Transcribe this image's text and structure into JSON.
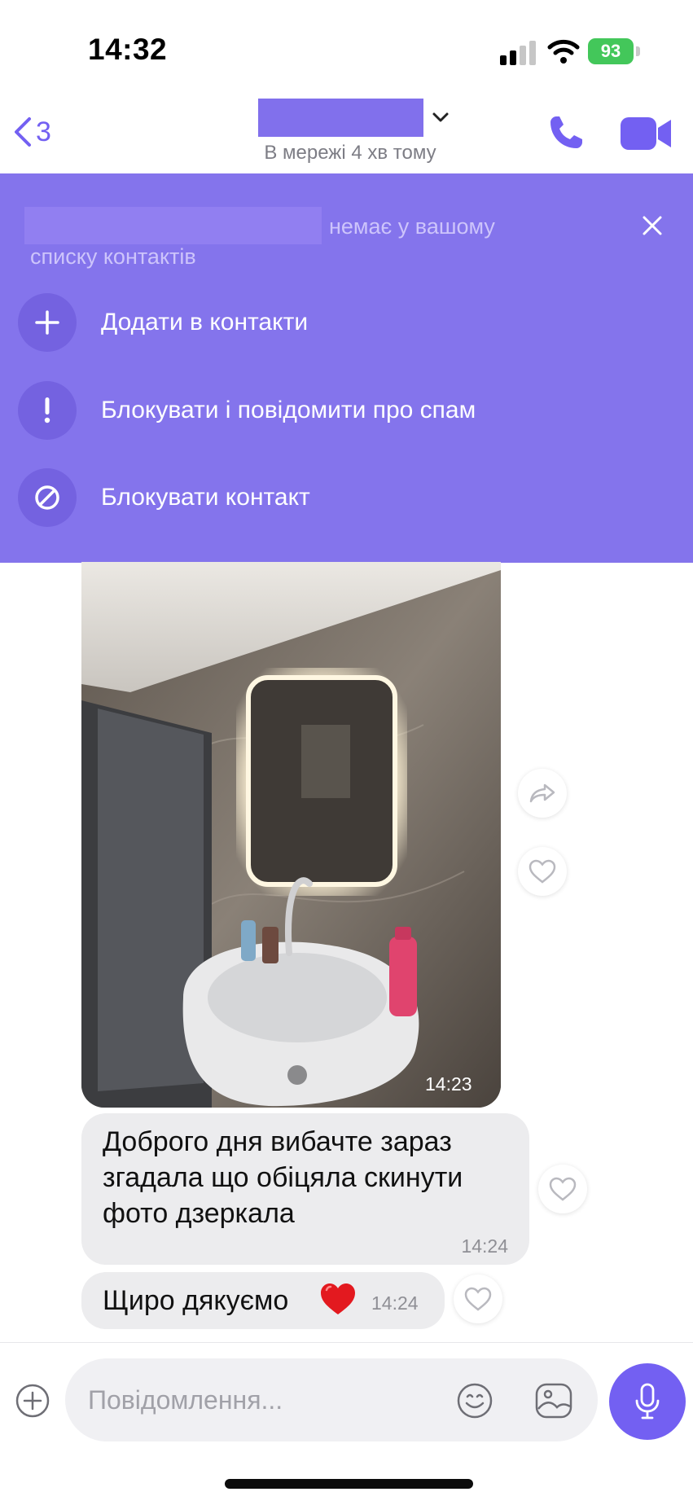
{
  "status_bar": {
    "time": "14:32",
    "battery": "93"
  },
  "header": {
    "back_count": "3",
    "last_seen": "В мережі 4 хв тому",
    "icons": [
      "chevron-left-icon",
      "chevron-down-icon",
      "phone-icon",
      "video-camera-icon"
    ]
  },
  "banner": {
    "not_in_contacts_line1": "немає у вашому",
    "not_in_contacts_line2": "списку контактів",
    "actions": [
      {
        "label": "Додати в контакти",
        "icon": "plus-icon"
      },
      {
        "label": "Блокувати і повідомити про спам",
        "icon": "exclamation-icon"
      },
      {
        "label": "Блокувати контакт",
        "icon": "block-icon"
      }
    ]
  },
  "messages": [
    {
      "type": "photo",
      "time": "14:23"
    },
    {
      "type": "text",
      "lines": [
        "Доброго дня вибачте зараз",
        "згадала що обіцяла скинути",
        "фото дзеркала"
      ],
      "time": "14:24"
    },
    {
      "type": "text",
      "text": "Щиро дякуємо",
      "emoji": "❤️",
      "time": "14:24"
    }
  ],
  "composer": {
    "placeholder": "Повідомлення..."
  },
  "colors": {
    "accent": "#7360f2",
    "banner": "#8474ec",
    "bubble": "#ececee"
  }
}
